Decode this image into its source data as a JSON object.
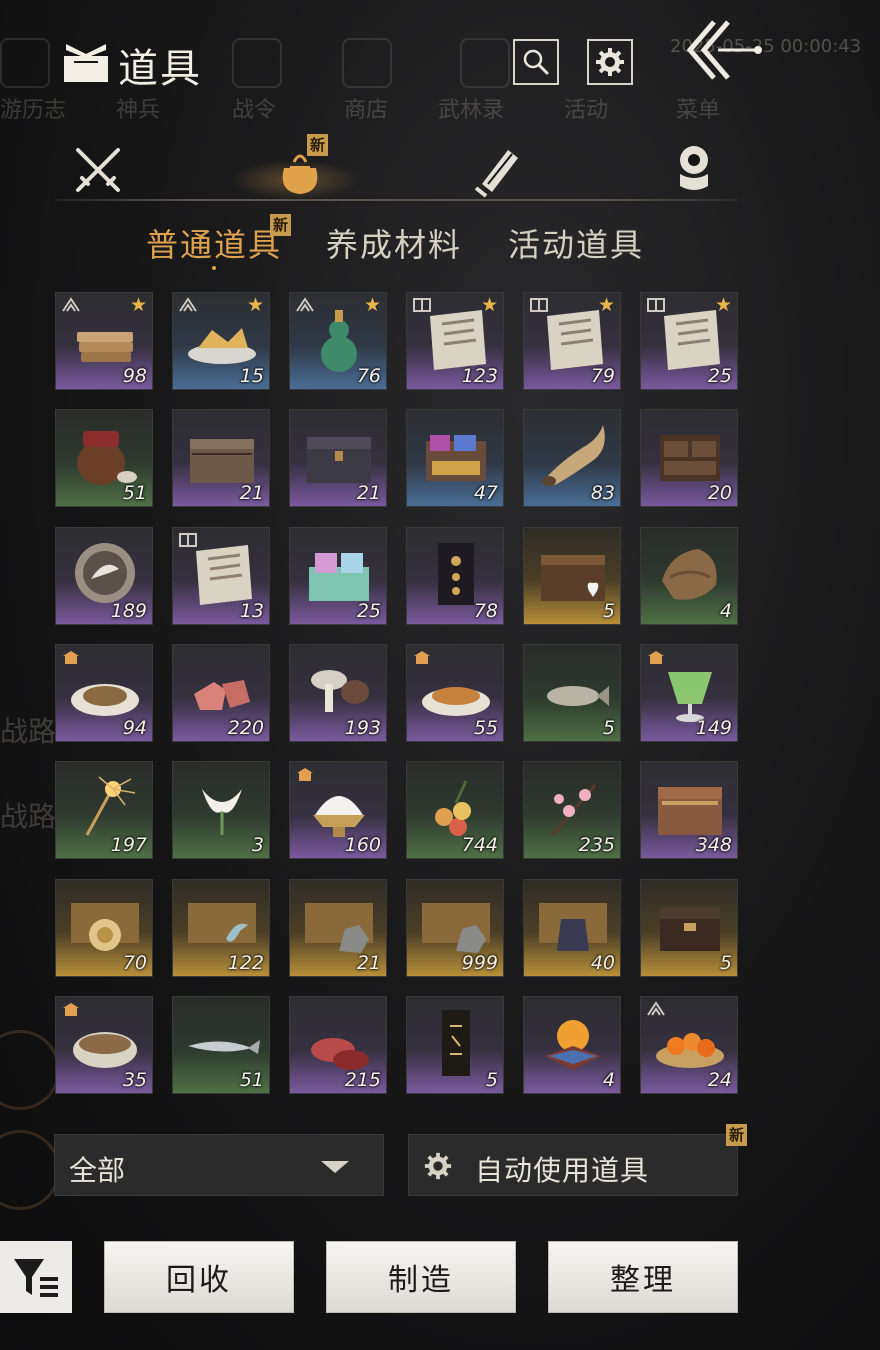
{
  "header": {
    "title": "道具",
    "timestamp": "2025-05-25 00:00:43",
    "search_icon": "search-icon",
    "settings_icon": "gear-icon",
    "back_icon": "double-chevron-left-icon"
  },
  "background_menu": [
    "游历志",
    "神兵",
    "战令",
    "商店",
    "武林录",
    "活动",
    "菜单"
  ],
  "background_side": [
    "战路",
    "战路"
  ],
  "categories": [
    {
      "icon": "crossed-swords-icon",
      "active": false
    },
    {
      "icon": "item-bag-icon",
      "active": true,
      "badge": "新"
    },
    {
      "icon": "scroll-icon",
      "active": false
    },
    {
      "icon": "ingot-icon",
      "active": false
    }
  ],
  "subtabs": [
    {
      "label": "普通道具",
      "active": true,
      "badge": "新"
    },
    {
      "label": "养成材料",
      "active": false
    },
    {
      "label": "活动道具",
      "active": false
    }
  ],
  "items": [
    {
      "name": "flatbread",
      "count": "98",
      "rarity": "purple",
      "star": true,
      "tag": "tier"
    },
    {
      "name": "fried-snacks",
      "count": "15",
      "rarity": "blue",
      "star": true,
      "tag": "tier"
    },
    {
      "name": "gourd-wine",
      "count": "76",
      "rarity": "blue",
      "star": true,
      "tag": "tier"
    },
    {
      "name": "recipe-page",
      "count": "123",
      "rarity": "purple",
      "star": true,
      "tag": "book"
    },
    {
      "name": "recipe-page",
      "count": "79",
      "rarity": "purple",
      "star": true,
      "tag": "book"
    },
    {
      "name": "recipe-page",
      "count": "25",
      "rarity": "purple",
      "star": true,
      "tag": "book"
    },
    {
      "name": "wine-jar",
      "count": "51",
      "rarity": "green",
      "star": false,
      "tag": ""
    },
    {
      "name": "wooden-chest",
      "count": "21",
      "rarity": "purple",
      "star": false,
      "tag": ""
    },
    {
      "name": "wooden-chest-dark",
      "count": "21",
      "rarity": "purple",
      "star": false,
      "tag": ""
    },
    {
      "name": "gift-drawers",
      "count": "47",
      "rarity": "blue",
      "star": false,
      "tag": ""
    },
    {
      "name": "horn",
      "count": "83",
      "rarity": "blue",
      "star": false,
      "tag": ""
    },
    {
      "name": "cabinet-chest",
      "count": "20",
      "rarity": "purple",
      "star": false,
      "tag": ""
    },
    {
      "name": "dove-token",
      "count": "189",
      "rarity": "purple",
      "star": false,
      "tag": ""
    },
    {
      "name": "recipe-page",
      "count": "13",
      "rarity": "purple",
      "star": false,
      "tag": "book"
    },
    {
      "name": "gift-box-jade",
      "count": "25",
      "rarity": "purple",
      "star": false,
      "tag": ""
    },
    {
      "name": "talisman",
      "count": "78",
      "rarity": "purple",
      "star": false,
      "tag": ""
    },
    {
      "name": "heart-chest",
      "count": "5",
      "rarity": "gold",
      "star": false,
      "tag": ""
    },
    {
      "name": "bark-cloth",
      "count": "4",
      "rarity": "green",
      "star": false,
      "tag": ""
    },
    {
      "name": "braised-dish",
      "count": "94",
      "rarity": "purple",
      "star": false,
      "tag": "house"
    },
    {
      "name": "raw-meat",
      "count": "220",
      "rarity": "purple",
      "star": false,
      "tag": ""
    },
    {
      "name": "mushrooms",
      "count": "193",
      "rarity": "purple",
      "star": false,
      "tag": ""
    },
    {
      "name": "fish-dish",
      "count": "55",
      "rarity": "purple",
      "star": false,
      "tag": "house"
    },
    {
      "name": "fish",
      "count": "5",
      "rarity": "green",
      "star": false,
      "tag": ""
    },
    {
      "name": "green-drink",
      "count": "149",
      "rarity": "purple",
      "star": false,
      "tag": "house"
    },
    {
      "name": "sparkler",
      "count": "197",
      "rarity": "green",
      "star": false,
      "tag": ""
    },
    {
      "name": "white-flower",
      "count": "3",
      "rarity": "green",
      "star": false,
      "tag": ""
    },
    {
      "name": "shaved-ice",
      "count": "160",
      "rarity": "purple",
      "star": false,
      "tag": "house"
    },
    {
      "name": "lychee",
      "count": "744",
      "rarity": "green",
      "star": false,
      "tag": ""
    },
    {
      "name": "plum-blossom",
      "count": "235",
      "rarity": "green",
      "star": false,
      "tag": ""
    },
    {
      "name": "ornate-chest",
      "count": "348",
      "rarity": "purple",
      "star": false,
      "tag": ""
    },
    {
      "name": "shell-chest",
      "count": "70",
      "rarity": "gold",
      "star": false,
      "tag": ""
    },
    {
      "name": "bird-chest",
      "count": "122",
      "rarity": "gold",
      "star": false,
      "tag": ""
    },
    {
      "name": "ore-chest",
      "count": "21",
      "rarity": "gold",
      "star": false,
      "tag": ""
    },
    {
      "name": "ore-chest",
      "count": "999",
      "rarity": "gold",
      "star": false,
      "tag": ""
    },
    {
      "name": "armor-chest",
      "count": "40",
      "rarity": "gold",
      "star": false,
      "tag": ""
    },
    {
      "name": "lacquer-box",
      "count": "5",
      "rarity": "gold",
      "star": false,
      "tag": ""
    },
    {
      "name": "stew-pot",
      "count": "35",
      "rarity": "purple",
      "star": false,
      "tag": "house"
    },
    {
      "name": "long-fish",
      "count": "51",
      "rarity": "green",
      "star": false,
      "tag": ""
    },
    {
      "name": "raw-steak",
      "count": "215",
      "rarity": "purple",
      "star": false,
      "tag": ""
    },
    {
      "name": "calligraphy-scroll",
      "count": "5",
      "rarity": "purple",
      "star": false,
      "tag": ""
    },
    {
      "name": "crystal-orb",
      "count": "4",
      "rarity": "purple",
      "star": false,
      "tag": ""
    },
    {
      "name": "persimmon-basket",
      "count": "24",
      "rarity": "purple",
      "star": false,
      "tag": "tier"
    }
  ],
  "filter": {
    "value": "全部"
  },
  "auto_use": {
    "label": "自动使用道具",
    "badge": "新"
  },
  "actions": {
    "recycle": "回收",
    "craft": "制造",
    "sort": "整理"
  },
  "colors": {
    "accent": "#dfa24f",
    "badge": "#c79b4e",
    "star": "#e8b54a"
  }
}
